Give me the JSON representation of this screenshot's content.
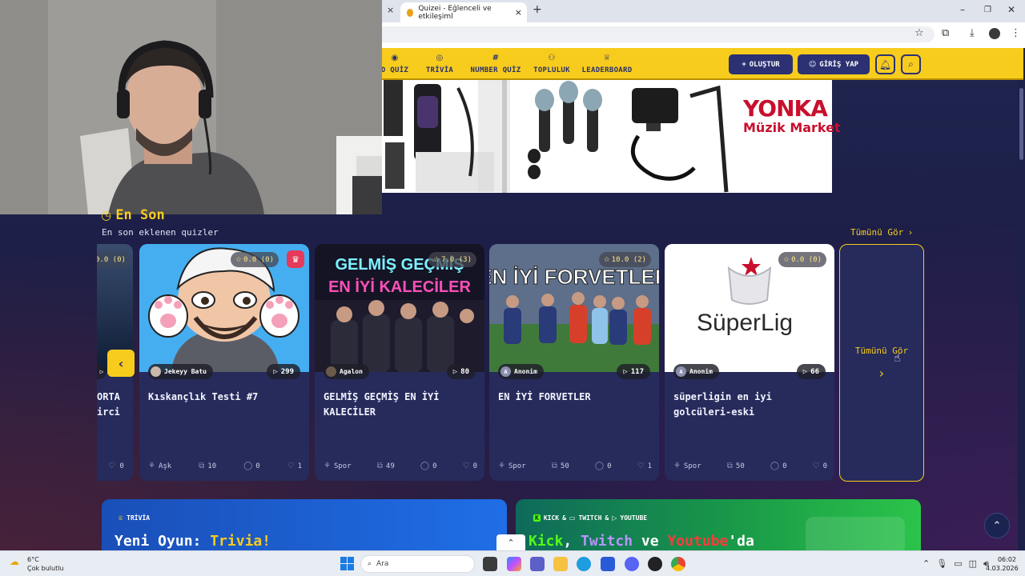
{
  "browser": {
    "active_tab_title": "Quizei - Eğlenceli ve etkileşiml",
    "tab_close_glyph": "×",
    "new_tab_glyph": "+"
  },
  "header": {
    "nav": [
      {
        "label": "O QUİZ",
        "icon": "camera-icon"
      },
      {
        "label": "TRİVİA",
        "icon": "chat-bubble-icon"
      },
      {
        "label": "NUMBER QUİZ",
        "icon": "hash-icon"
      },
      {
        "label": "TOPLULUK",
        "icon": "users-icon"
      },
      {
        "label": "LEADERBOARD",
        "icon": "trophy-icon"
      }
    ],
    "create_label": "OLUŞTUR",
    "login_label": "GİRİŞ YAP"
  },
  "ad": {
    "brand_line1": "YONKA",
    "brand_line2": "Müzik Market"
  },
  "section": {
    "title": "En Son",
    "subtitle": "En son eklenen quizler",
    "see_all": "Tümünü Gör"
  },
  "partial_card": {
    "rating": "0.0 (0)",
    "title_line1": "ORTA",
    "title_line2": "irci",
    "likes": "0"
  },
  "cards": [
    {
      "rating": "0.0 (0)",
      "author": "Jekeyy Batu",
      "plays": "299",
      "title": "Kıskançlık Testi #7",
      "category": "Aşk",
      "questions": "10",
      "comments": "0",
      "likes": "1",
      "premium": true
    },
    {
      "rating": "7.0 (3)",
      "author": "Agalon",
      "plays": "80",
      "title": "GELMİŞ GEÇMİŞ EN İYİ KALECİLER",
      "category": "Spor",
      "questions": "49",
      "comments": "0",
      "likes": "0",
      "premium": false
    },
    {
      "rating": "10.0 (2)",
      "author": "Anonim",
      "plays": "117",
      "title": "EN İYİ FORVETLER",
      "category": "Spor",
      "questions": "50",
      "comments": "0",
      "likes": "1",
      "premium": false
    },
    {
      "rating": "0.0 (0)",
      "author": "Anonim",
      "plays": "66",
      "title": "süperligin en iyi golcüleri-eski",
      "category": "Spor",
      "questions": "50",
      "comments": "0",
      "likes": "0",
      "premium": false
    }
  ],
  "thumb_texts": {
    "kaleciler_line1": "GELMİŞ GEÇMİŞ",
    "kaleciler_line2": "EN İYİ KALECİLER",
    "forvetler": "EN İYİ FORVETLER",
    "superlig": "SüperLig"
  },
  "see_all_card": {
    "label": "Tümünü Gör"
  },
  "promos": {
    "left_tag": "TRİVİA",
    "left_title_a": "Yeni Oyun: ",
    "left_title_b": "Trivia!",
    "right_tag_kick": "KICK",
    "right_tag_amp1": "&",
    "right_tag_twitch": "TWITCH",
    "right_tag_amp2": "&",
    "right_tag_youtube": "YOUTUBE",
    "right_title_kick": "Kick",
    "right_title_comma": ", ",
    "right_title_twitch": "Twitch",
    "right_title_ve": " ve ",
    "right_title_youtube": "Youtube",
    "right_title_da": "'da"
  },
  "taskbar": {
    "temperature": "6°C",
    "weather": "Çok bulutlu",
    "search": "Ara",
    "time": "06:02",
    "date": "4.03.2026"
  },
  "colors": {
    "accent_yellow": "#f8cc1d",
    "navy": "#29306a",
    "card_bg": "#262b5b",
    "premium_red": "#e53a5a"
  }
}
